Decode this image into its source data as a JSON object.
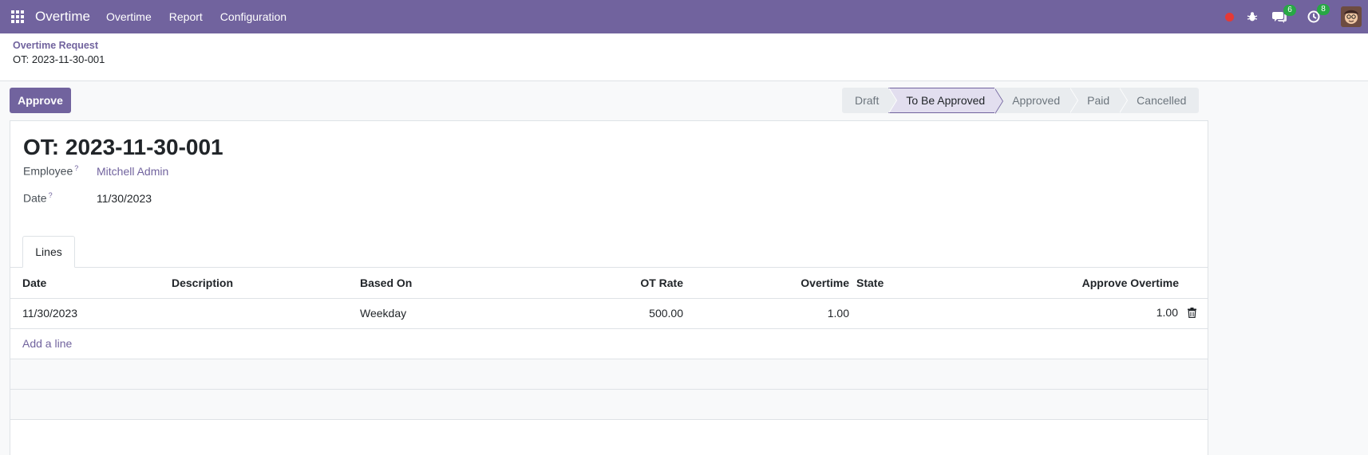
{
  "navbar": {
    "app_name": "Overtime",
    "menu": [
      "Overtime",
      "Report",
      "Configuration"
    ],
    "messages_count": "6",
    "activities_count": "8",
    "colors": {
      "bar": "#71639e",
      "badge": "#28a745",
      "record_dot": "#e53935"
    }
  },
  "breadcrumb": {
    "parent": "Overtime Request",
    "current": "OT: 2023-11-30-001"
  },
  "actions": {
    "approve": "Approve"
  },
  "statusbar": {
    "stages": [
      "Draft",
      "To Be Approved",
      "Approved",
      "Paid",
      "Cancelled"
    ],
    "active": "To Be Approved"
  },
  "form": {
    "title": "OT: 2023-11-30-001",
    "employee_label": "Employee",
    "employee_value": "Mitchell Admin",
    "date_label": "Date",
    "date_value": "11/30/2023",
    "help_mark": "?",
    "tab_label": "Lines"
  },
  "lines": {
    "columns": [
      "Date",
      "Description",
      "Based On",
      "OT Rate",
      "Overtime",
      "State",
      "Approve Overtime"
    ],
    "rows": [
      {
        "date": "11/30/2023",
        "description": "",
        "based_on": "Weekday",
        "ot_rate": "500.00",
        "overtime": "1.00",
        "state": "",
        "approve_overtime": "1.00"
      }
    ],
    "add_line": "Add a line"
  }
}
